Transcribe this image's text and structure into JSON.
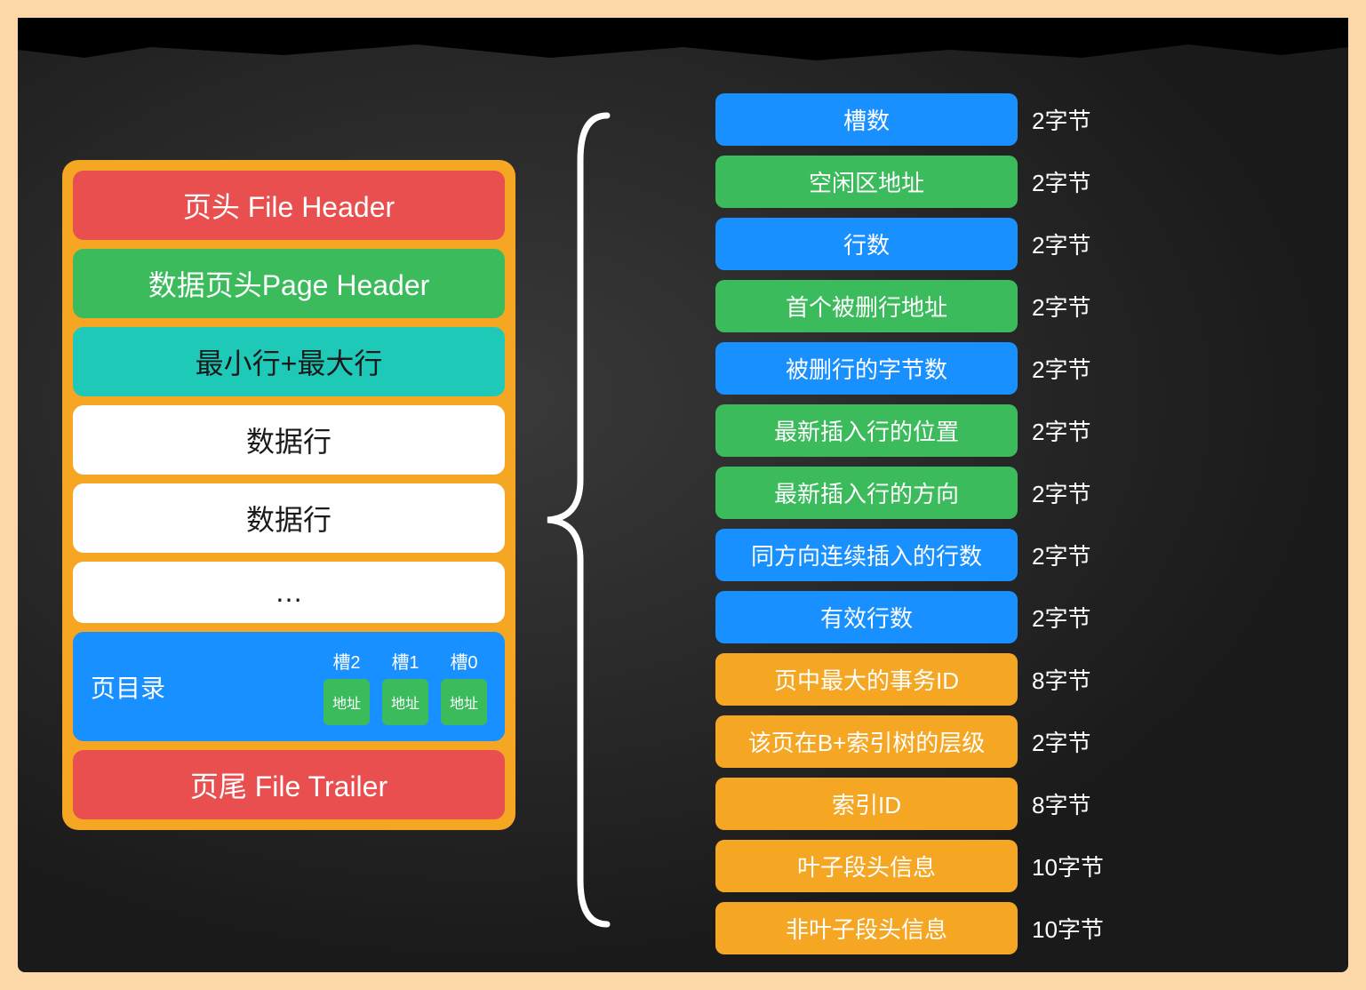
{
  "colors": {
    "red": "#e94f4f",
    "green": "#3bbb5c",
    "teal": "#1fc9b8",
    "white": "#ffffff",
    "blue": "#1890ff",
    "orange": "#f5a623"
  },
  "left": {
    "file_header": "页头 File Header",
    "page_header": "数据页头Page Header",
    "min_max_row": "最小行+最大行",
    "data_row": "数据行",
    "ellipsis": "…",
    "directory": {
      "label": "页目录",
      "slots": [
        {
          "label": "槽2",
          "box": "地址"
        },
        {
          "label": "槽1",
          "box": "地址"
        },
        {
          "label": "槽0",
          "box": "地址"
        }
      ]
    },
    "file_trailer": "页尾 File Trailer"
  },
  "right": {
    "fields": [
      {
        "label": "槽数",
        "bytes": "2字节",
        "color": "blue"
      },
      {
        "label": "空闲区地址",
        "bytes": "2字节",
        "color": "green"
      },
      {
        "label": "行数",
        "bytes": "2字节",
        "color": "blue"
      },
      {
        "label": "首个被删行地址",
        "bytes": "2字节",
        "color": "green"
      },
      {
        "label": "被删行的字节数",
        "bytes": "2字节",
        "color": "blue"
      },
      {
        "label": "最新插入行的位置",
        "bytes": "2字节",
        "color": "green"
      },
      {
        "label": "最新插入行的方向",
        "bytes": "2字节",
        "color": "green"
      },
      {
        "label": "同方向连续插入的行数",
        "bytes": "2字节",
        "color": "blue"
      },
      {
        "label": "有效行数",
        "bytes": "2字节",
        "color": "blue"
      },
      {
        "label": "页中最大的事务ID",
        "bytes": "8字节",
        "color": "orange"
      },
      {
        "label": "该页在B+索引树的层级",
        "bytes": "2字节",
        "color": "orange"
      },
      {
        "label": "索引ID",
        "bytes": "8字节",
        "color": "orange"
      },
      {
        "label": "叶子段头信息",
        "bytes": "10字节",
        "color": "orange"
      },
      {
        "label": "非叶子段头信息",
        "bytes": "10字节",
        "color": "orange"
      }
    ]
  }
}
